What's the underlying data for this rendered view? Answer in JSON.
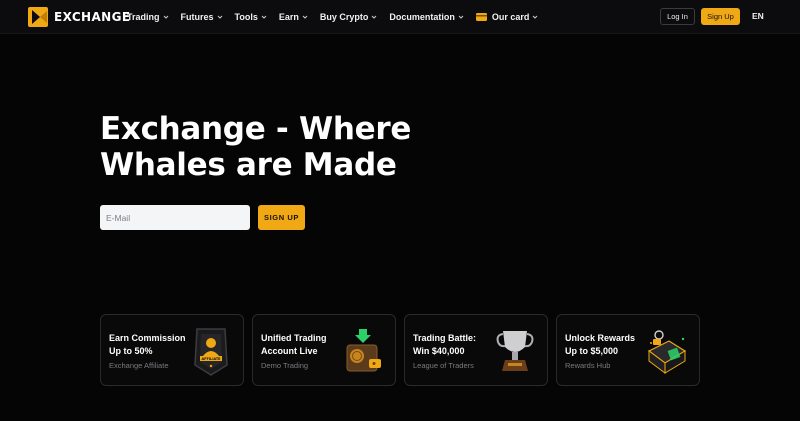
{
  "brand": {
    "name": "EXCHANGE",
    "accent": "#f0a814"
  },
  "nav": {
    "items": [
      {
        "label": "Trading",
        "icon": "chevron-down-icon"
      },
      {
        "label": "Futures",
        "icon": "chevron-down-icon"
      },
      {
        "label": "Tools",
        "icon": "chevron-down-icon"
      },
      {
        "label": "Earn",
        "icon": "chevron-down-icon"
      },
      {
        "label": "Buy Crypto",
        "icon": "chevron-down-icon"
      },
      {
        "label": "Documentation",
        "icon": "chevron-down-icon"
      },
      {
        "label": "Our card",
        "icon": "card-icon"
      }
    ],
    "login_label": "Log In",
    "signup_label": "Sign Up",
    "language": "EN"
  },
  "hero": {
    "title_line1": "Exchange - Where",
    "title_line2": "Whales are Made",
    "email_placeholder": "E-Mail",
    "signup_label": "SIGN UP"
  },
  "cards": [
    {
      "title_line1": "Earn Commission",
      "title_line2": "Up to 50%",
      "subtitle": "Exchange Affiliate",
      "icon": "affiliate-badge-icon",
      "badge_text": "AFFILIATE"
    },
    {
      "title_line1": "Unified Trading",
      "title_line2": "Account Live",
      "subtitle": "Demo Trading",
      "icon": "wallet-icon"
    },
    {
      "title_line1": "Trading Battle:",
      "title_line2": "Win $40,000",
      "subtitle": "League of Traders",
      "icon": "trophy-icon"
    },
    {
      "title_line1": "Unlock Rewards",
      "title_line2": "Up to $5,000",
      "subtitle": "Rewards Hub",
      "icon": "gift-box-icon"
    }
  ]
}
